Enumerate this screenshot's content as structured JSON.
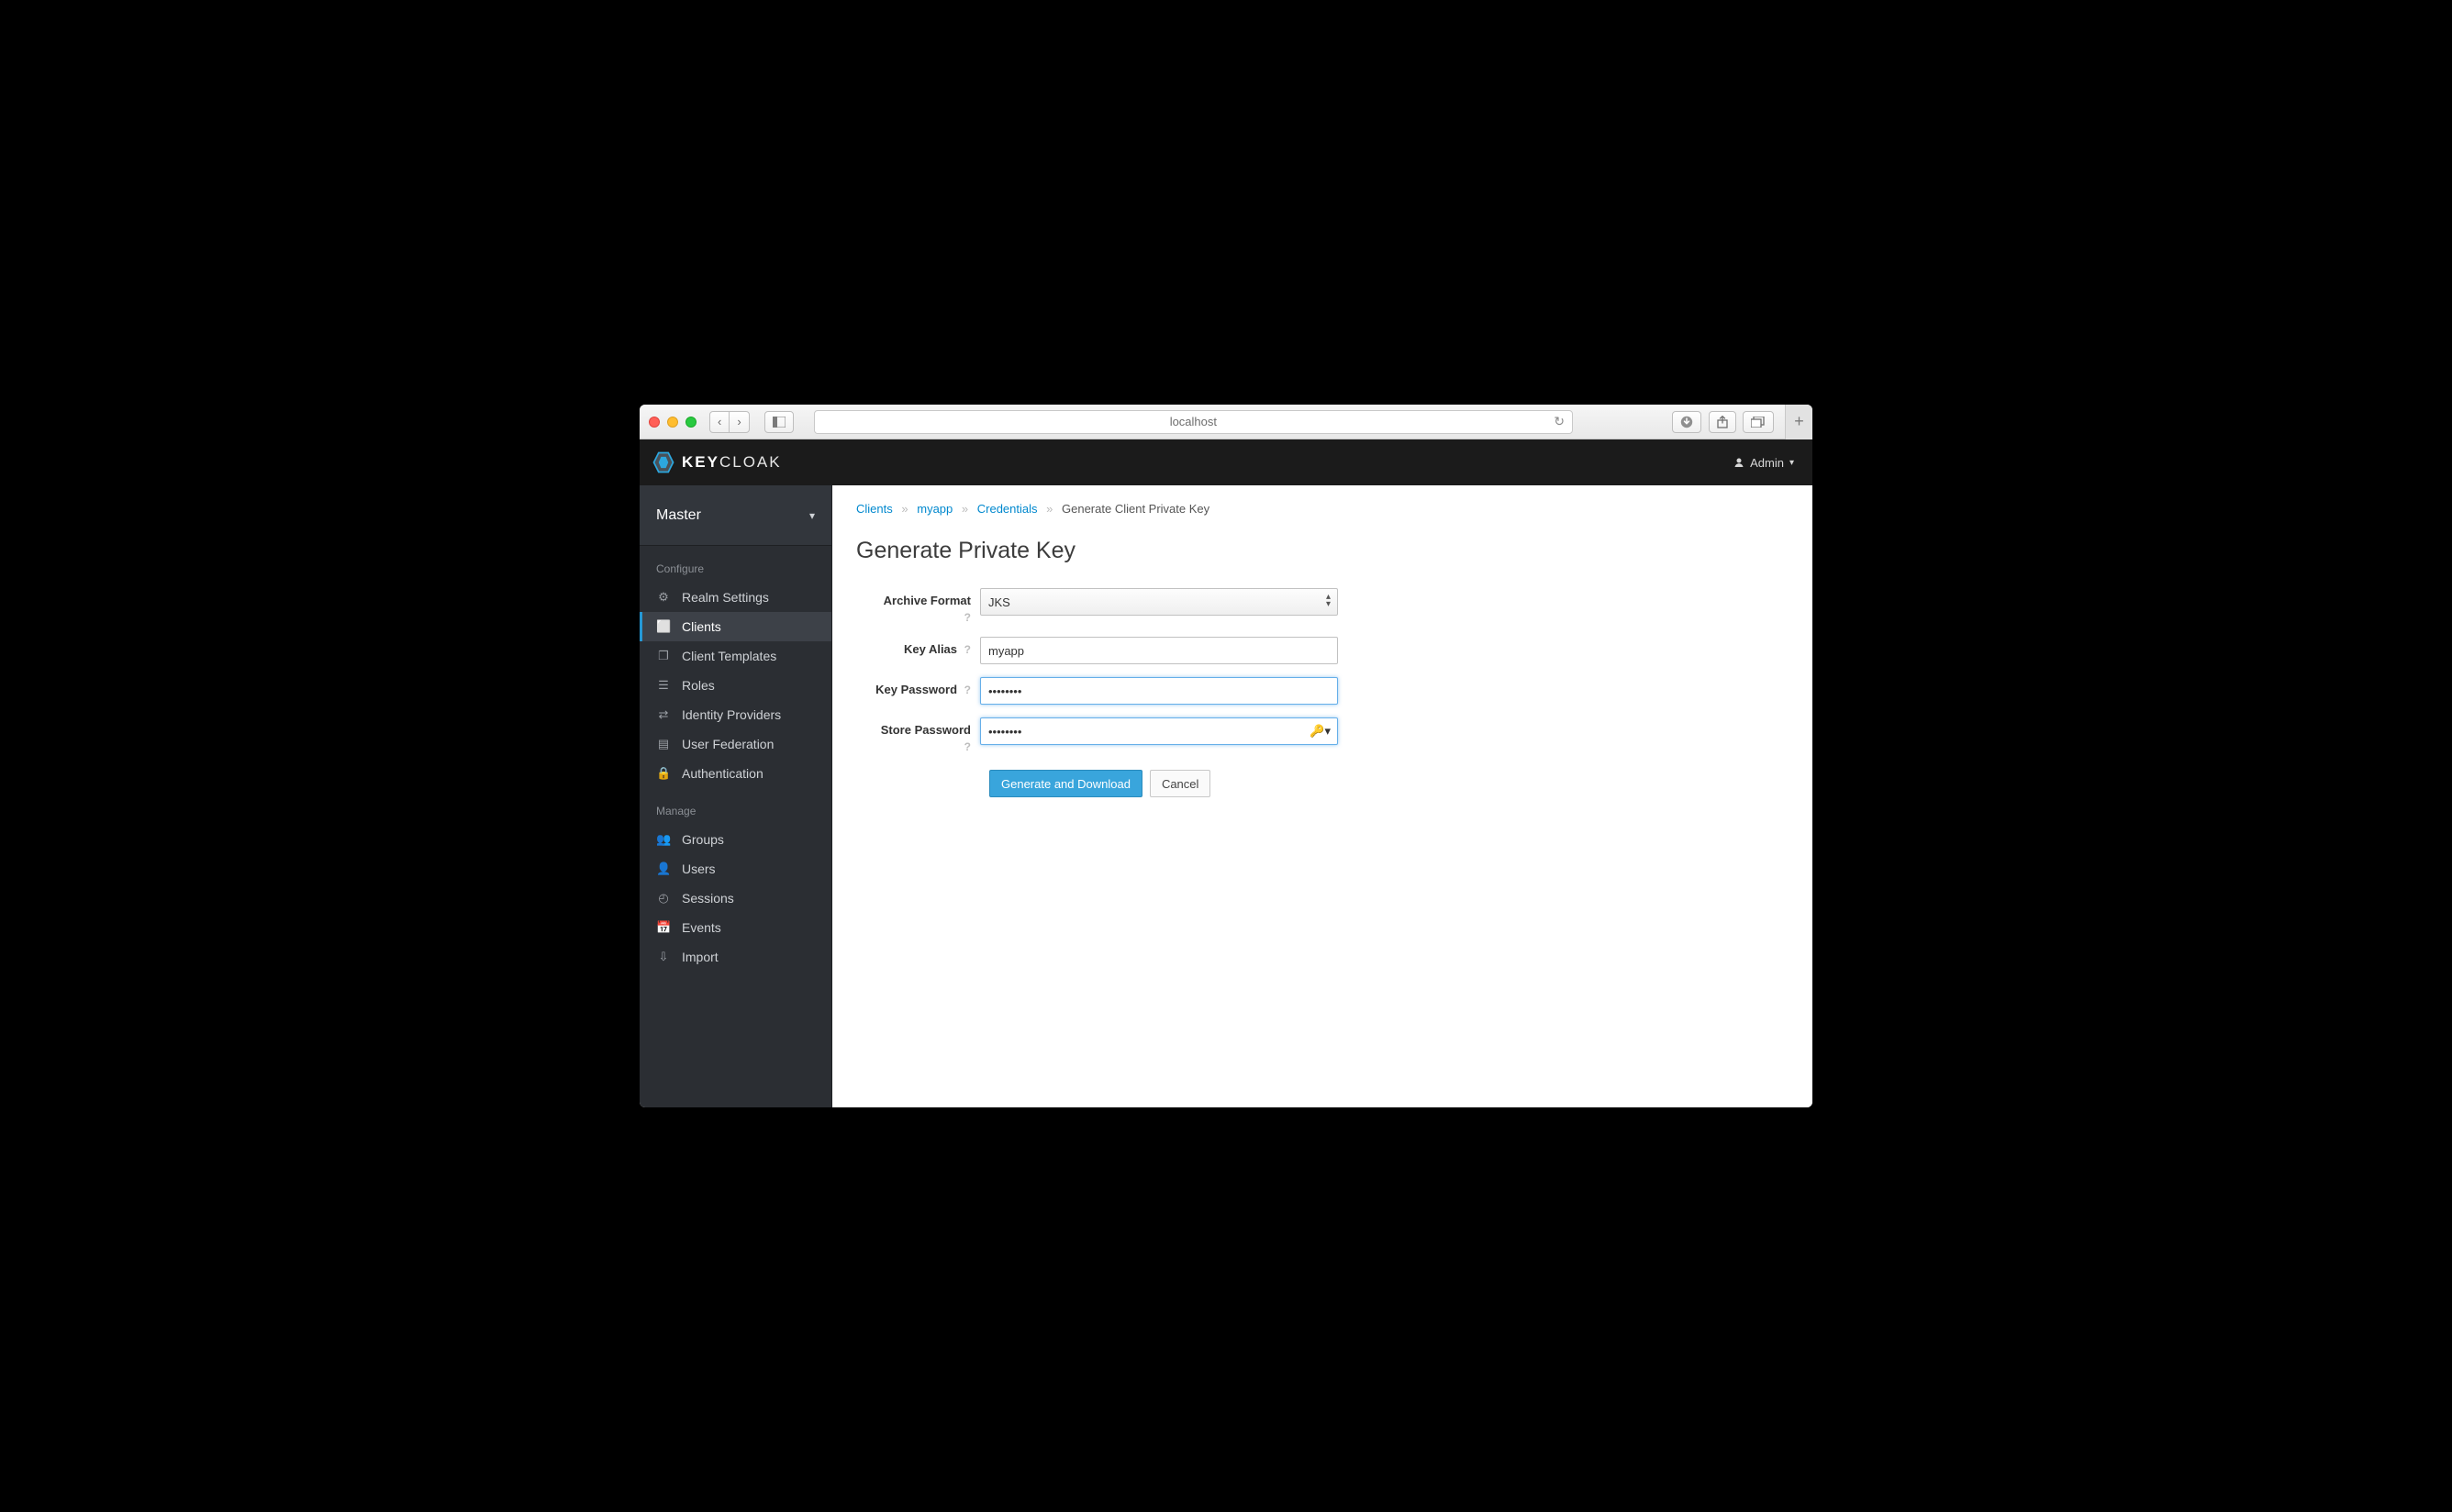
{
  "browser": {
    "url_display": "localhost"
  },
  "header": {
    "brand_pre": "KEY",
    "brand_post": "CLOAK",
    "user_label": "Admin"
  },
  "sidebar": {
    "realm": "Master",
    "section_configure": "Configure",
    "section_manage": "Manage",
    "configure": [
      {
        "label": "Realm Settings",
        "icon": "sliders"
      },
      {
        "label": "Clients",
        "icon": "cube",
        "active": true
      },
      {
        "label": "Client Templates",
        "icon": "cubes"
      },
      {
        "label": "Roles",
        "icon": "list"
      },
      {
        "label": "Identity Providers",
        "icon": "exchange"
      },
      {
        "label": "User Federation",
        "icon": "database"
      },
      {
        "label": "Authentication",
        "icon": "lock"
      }
    ],
    "manage": [
      {
        "label": "Groups",
        "icon": "users"
      },
      {
        "label": "Users",
        "icon": "user"
      },
      {
        "label": "Sessions",
        "icon": "clock"
      },
      {
        "label": "Events",
        "icon": "calendar"
      },
      {
        "label": "Import",
        "icon": "import"
      }
    ]
  },
  "breadcrumbs": {
    "items": [
      "Clients",
      "myapp",
      "Credentials"
    ],
    "current": "Generate Client Private Key"
  },
  "page": {
    "title": "Generate Private Key"
  },
  "form": {
    "archive_format": {
      "label": "Archive Format",
      "value": "JKS"
    },
    "key_alias": {
      "label": "Key Alias",
      "value": "myapp"
    },
    "key_password": {
      "label": "Key Password",
      "value": "••••••••"
    },
    "store_password": {
      "label": "Store Password",
      "value": "••••••••"
    },
    "submit_label": "Generate and Download",
    "cancel_label": "Cancel"
  }
}
